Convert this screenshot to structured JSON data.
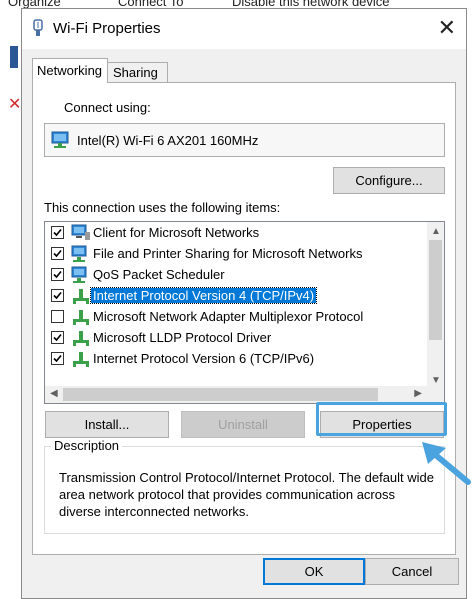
{
  "background": {
    "top_items": [
      "Organize",
      "Connect To",
      "Disable this network device"
    ]
  },
  "dialog": {
    "title": "Wi-Fi Properties",
    "close_glyph": "✕",
    "tabs": [
      {
        "label": "Networking",
        "active": true
      },
      {
        "label": "Sharing",
        "active": false
      }
    ],
    "connect_using_label": "Connect using:",
    "adapter_name": "Intel(R) Wi-Fi 6 AX201 160MHz",
    "configure_button": "Configure...",
    "items_label": "This connection uses the following items:",
    "items": [
      {
        "label": "Client for Microsoft Networks",
        "checked": true,
        "icon": "network-client-icon"
      },
      {
        "label": "File and Printer Sharing for Microsoft Networks",
        "checked": true,
        "icon": "network-service-icon"
      },
      {
        "label": "QoS Packet Scheduler",
        "checked": true,
        "icon": "network-service-icon"
      },
      {
        "label": "Internet Protocol Version 4 (TCP/IPv4)",
        "checked": true,
        "icon": "protocol-icon",
        "selected": true
      },
      {
        "label": "Microsoft Network Adapter Multiplexor Protocol",
        "checked": false,
        "icon": "protocol-icon"
      },
      {
        "label": "Microsoft LLDP Protocol Driver",
        "checked": true,
        "icon": "protocol-icon"
      },
      {
        "label": "Internet Protocol Version 6 (TCP/IPv6)",
        "checked": true,
        "icon": "protocol-icon"
      }
    ],
    "install_button": "Install...",
    "uninstall_button": "Uninstall",
    "properties_button": "Properties",
    "description_legend": "Description",
    "description_text": "Transmission Control Protocol/Internet Protocol. The default wide area network protocol that provides communication across diverse interconnected networks.",
    "ok_button": "OK",
    "cancel_button": "Cancel"
  },
  "colors": {
    "selection": "#0078d7",
    "highlight_callout": "#4aa3df"
  }
}
